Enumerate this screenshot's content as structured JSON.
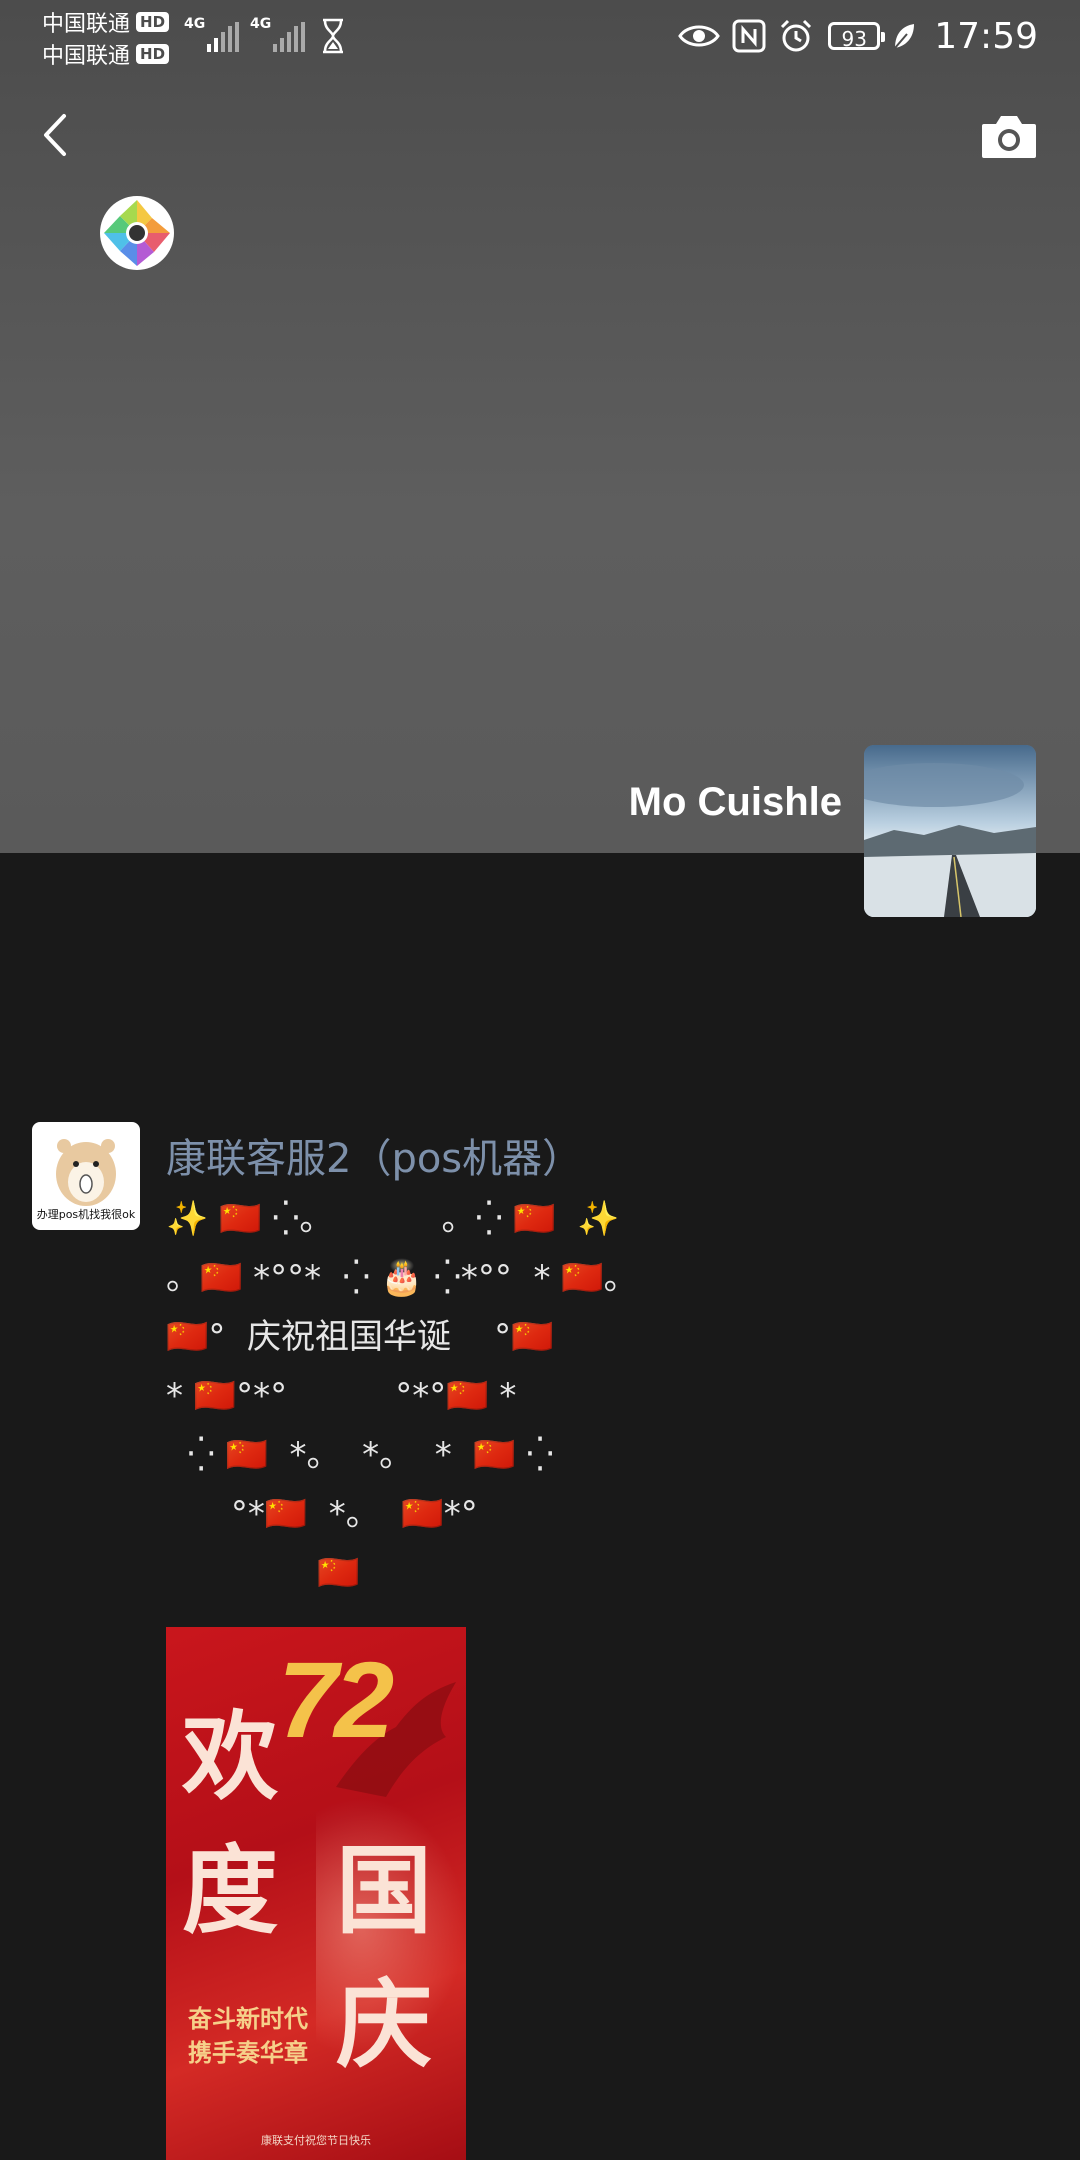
{
  "status_bar": {
    "carrier1": "中国联通",
    "carrier2": "中国联通",
    "hd_badge": "HD",
    "network1": "4G",
    "network2": "4G",
    "battery": "93",
    "time": "17:59"
  },
  "nav": {
    "back_icon": "chevron-left-icon",
    "camera_icon": "camera-icon"
  },
  "profile": {
    "name": "Mo Cuishle",
    "avatar_icon": "snowy-road-landscape"
  },
  "post": {
    "author": "康联客服2（pos机器）",
    "avatar_caption": "办理pos机找我很ok",
    "lines": [
      "✨ 🇨🇳 ⁛。          。⁛ 🇨🇳  ✨",
      "。🇨🇳 *°°*  ⁛ 🎂 ⁛*°°  * 🇨🇳。",
      "🇨🇳°  庆祝祖国华诞    °🇨🇳",
      "* 🇨🇳°*°          °*°🇨🇳 *",
      "  ⁛ 🇨🇳  *。  *。  *  🇨🇳 ⁛",
      "      °*🇨🇳  *。  🇨🇳*°",
      "              🇨🇳"
    ],
    "poster": {
      "number": "72",
      "char1": "欢",
      "char2": "度",
      "char3": "国",
      "char4": "庆",
      "slogan1": "奋斗新时代",
      "slogan2": "携手奏华章",
      "footer": "康联支付祝您节日快乐"
    }
  },
  "colors": {
    "cover_bg": "#575757",
    "page_bg": "#191919",
    "author_name": "#7d90aa",
    "poster_red": "#c9161c",
    "poster_gold": "#f4c24a"
  }
}
